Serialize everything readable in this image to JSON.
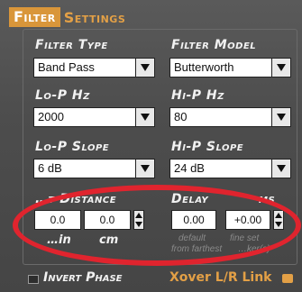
{
  "title": {
    "highlight": "Filter",
    "rest": "Settings"
  },
  "filter_type": {
    "label": "Filter Type",
    "value": "Band Pass"
  },
  "filter_model": {
    "label": "Filter Model",
    "value": "Butterworth"
  },
  "lop_hz": {
    "label": "Lo-P  Hz",
    "value": "2000"
  },
  "hip_hz": {
    "label": "Hi-P  Hz",
    "value": "80"
  },
  "lop_slope": {
    "label": "Lo-P Slope",
    "value": "6 dB"
  },
  "hip_slope": {
    "label": "Hi-P Slope",
    "value": "24 dB"
  },
  "distance": {
    "label": "…t Distance",
    "value_1": "0.0",
    "value_2": "0.0",
    "unit_1": "…in",
    "unit_2": "cm"
  },
  "delay": {
    "label": "Delay",
    "unit": "ms",
    "value_1": "0.00",
    "value_2": "+0.00",
    "hint_1": "default",
    "hint_2": "from farthest",
    "hint_3": "fine set",
    "hint_4": "…ker(s)"
  },
  "invert_phase": {
    "label": "Invert Phase"
  },
  "xover_link": {
    "label": "Xover L/R Link"
  },
  "colors": {
    "accent": "#e3a046",
    "annotation": "#e0242e"
  }
}
